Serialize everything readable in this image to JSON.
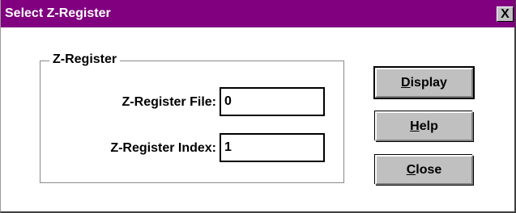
{
  "window": {
    "title": "Select Z-Register",
    "close_glyph": "X",
    "titlebar_color": "#800080"
  },
  "group": {
    "label": "Z-Register"
  },
  "fields": {
    "file": {
      "label": "Z-Register File:",
      "value": "0"
    },
    "index": {
      "label": "Z-Register Index:",
      "value": "1"
    }
  },
  "buttons": {
    "display": {
      "accel": "D",
      "rest": "isplay"
    },
    "help": {
      "accel": "H",
      "rest": "elp"
    },
    "close": {
      "accel": "C",
      "rest": "lose"
    }
  }
}
